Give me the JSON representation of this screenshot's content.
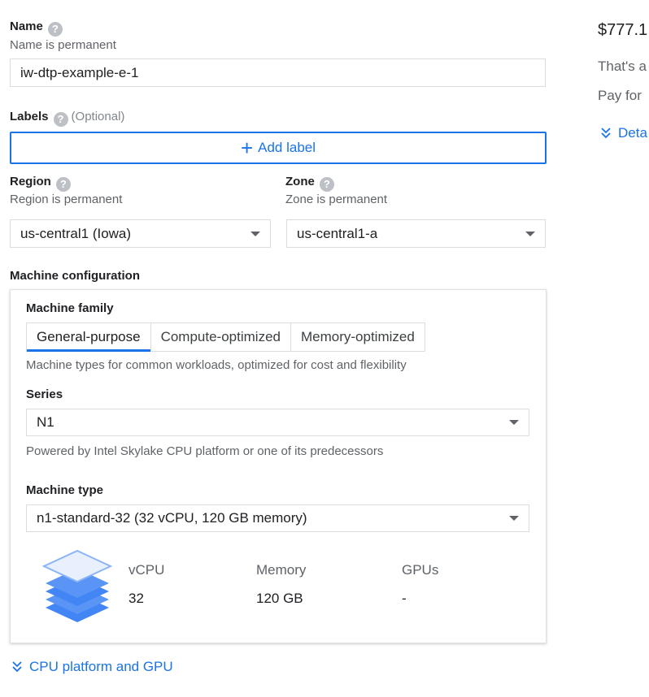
{
  "name_section": {
    "label": "Name",
    "help": "?",
    "hint": "Name is permanent",
    "value": "iw-dtp-example-e-1"
  },
  "labels_section": {
    "label": "Labels",
    "help": "?",
    "optional": "(Optional)",
    "add_label": "Add label",
    "add_icon": "+"
  },
  "region": {
    "label": "Region",
    "help": "?",
    "hint": "Region is permanent",
    "value": "us-central1 (Iowa)"
  },
  "zone": {
    "label": "Zone",
    "help": "?",
    "hint": "Zone is permanent",
    "value": "us-central1-a"
  },
  "machine_config": {
    "title": "Machine configuration",
    "family_label": "Machine family",
    "tabs": [
      {
        "label": "General-purpose",
        "active": true
      },
      {
        "label": "Compute-optimized",
        "active": false
      },
      {
        "label": "Memory-optimized",
        "active": false
      }
    ],
    "family_desc": "Machine types for common workloads, optimized for cost and flexibility",
    "series_label": "Series",
    "series_value": "N1",
    "series_desc": "Powered by Intel Skylake CPU platform or one of its predecessors",
    "type_label": "Machine type",
    "type_value": "n1-standard-32 (32 vCPU, 120 GB memory)",
    "specs": {
      "vcpu_label": "vCPU",
      "vcpu_value": "32",
      "memory_label": "Memory",
      "memory_value": "120 GB",
      "gpus_label": "GPUs",
      "gpus_value": "-"
    }
  },
  "cpu_link": "CPU platform and GPU",
  "right_panel": {
    "price": "$777.1",
    "line1": "That's a",
    "line2": "Pay for",
    "details": "Deta"
  },
  "colors": {
    "accent": "#1a73e8",
    "border": "#dadce0",
    "muted": "#5f6368"
  }
}
